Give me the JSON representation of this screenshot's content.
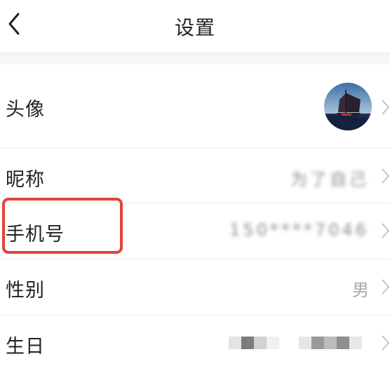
{
  "header": {
    "title": "设置"
  },
  "rows": [
    {
      "label": "头像",
      "value": ""
    },
    {
      "label": "昵称",
      "value": "为了自己"
    },
    {
      "label": "手机号",
      "value": "150****7046"
    },
    {
      "label": "性别",
      "value": "男"
    },
    {
      "label": "生日",
      "value": ""
    }
  ],
  "icons": {
    "back": "chevron-left-icon",
    "row_arrow": "chevron-right-icon",
    "avatar": "sailboat-photo-avatar"
  },
  "colors": {
    "highlight": "#e2443a",
    "value_text": "#a8a8a8",
    "section_gap": "#f6f6f6"
  }
}
